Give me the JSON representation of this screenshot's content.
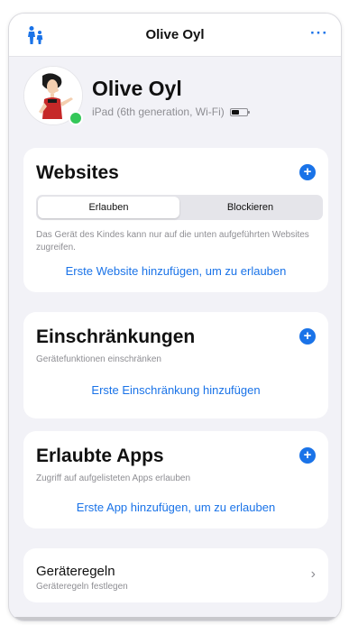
{
  "topbar": {
    "title": "Olive Oyl",
    "more_label": "···",
    "left_icon": "family-icon"
  },
  "profile": {
    "name": "Olive Oyl",
    "device": "iPad (6th generation, Wi-Fi)",
    "status": "online",
    "status_color": "#34c759"
  },
  "websites": {
    "title": "Websites",
    "segments": [
      "Erlauben",
      "Blockieren"
    ],
    "selected_segment": "Erlauben",
    "description": "Das Gerät des Kindes kann nur auf die unten aufgeführten Websites zugreifen.",
    "action": "Erste Website hinzufügen, um zu erlauben"
  },
  "restrictions": {
    "title": "Einschränkungen",
    "subtitle": "Gerätefunktionen einschränken",
    "action": "Erste Einschränkung hinzufügen"
  },
  "apps": {
    "title": "Erlaubte Apps",
    "subtitle": "Zugriff auf aufgelisteten Apps erlauben",
    "action": "Erste App hinzufügen, um zu erlauben"
  },
  "device_rules": {
    "title": "Geräteregeln",
    "subtitle": "Geräteregeln festlegen"
  },
  "colors": {
    "accent": "#1a73e8",
    "background": "#f2f2f7"
  }
}
